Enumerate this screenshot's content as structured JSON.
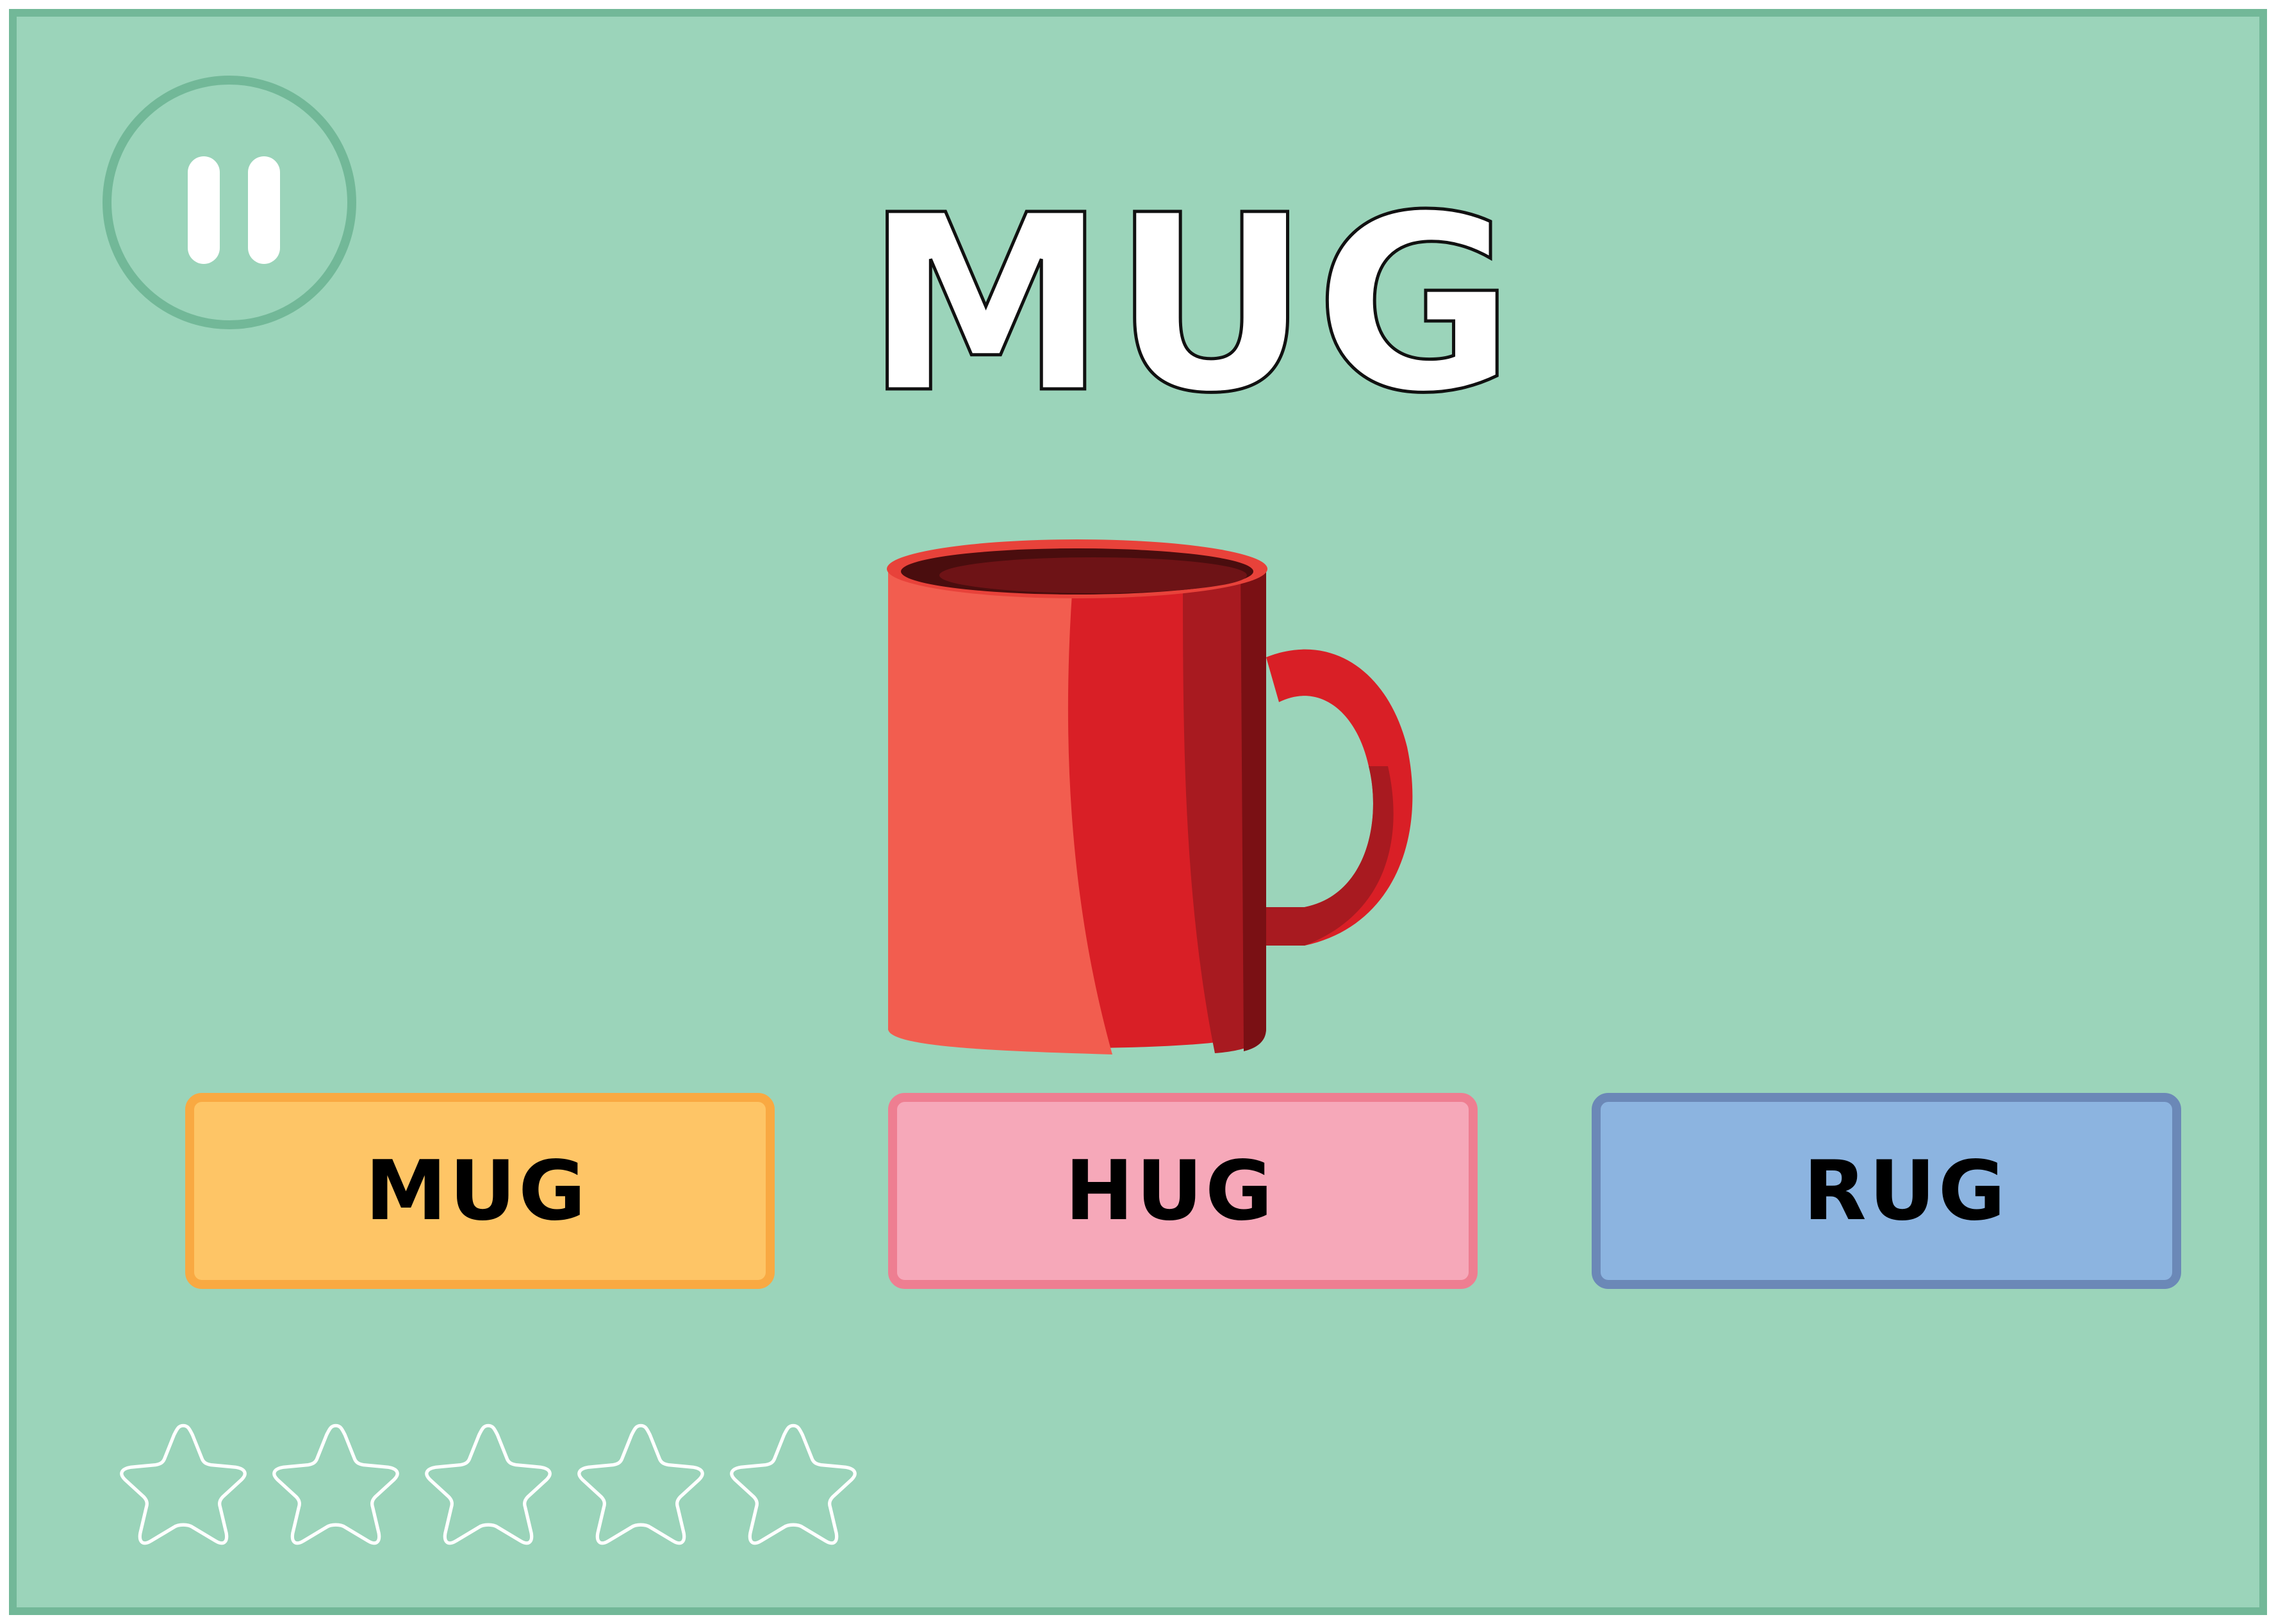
{
  "game": {
    "target_word": "MUG",
    "picture": "red-mug",
    "choices": [
      {
        "label": "MUG",
        "color": "#fec566",
        "border": "#f9a942"
      },
      {
        "label": "HUG",
        "color": "#f6a8b9",
        "border": "#ee7e91"
      },
      {
        "label": "RUG",
        "color": "#8cb4e0",
        "border": "#6b88b7"
      }
    ],
    "stars": {
      "earned": 0,
      "total": 5
    }
  },
  "controls": {
    "pause_icon": "pause-icon"
  },
  "colors": {
    "background": "#9bd4ba",
    "frame_border": "#72b898",
    "mug_red": "#d91f26"
  }
}
